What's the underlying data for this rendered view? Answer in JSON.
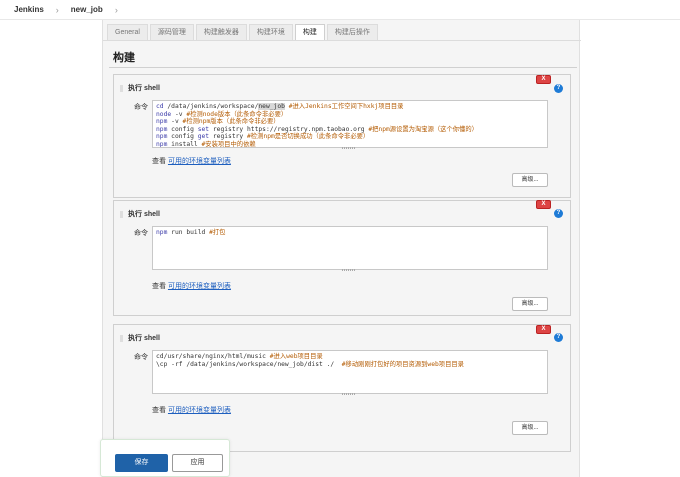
{
  "breadcrumb": {
    "root": "Jenkins",
    "sep": "›",
    "job": "new_job",
    "sep2": "›"
  },
  "tabs": [
    {
      "label": "General"
    },
    {
      "label": "源码管理"
    },
    {
      "label": "构建触发器"
    },
    {
      "label": "构建环境"
    },
    {
      "label": "构建",
      "active": true
    },
    {
      "label": "构建后操作"
    }
  ],
  "section_title": "构建",
  "steps": [
    {
      "title": "执行 shell",
      "delete": "X",
      "help": "?",
      "command_label": "命令",
      "lines": [
        "cd /data/jenkins/workspace/new_job #进入Jenkins工作空间下hxkj项目目录",
        "node -v #检测node版本（此条命令非必要）",
        "npm -v #检测npm版本（此条命令非必要）",
        "npm config set registry https://registry.npm.taobao.org #把npm源设置为淘宝源（这个你懂的）",
        "npm config get registry #检测npm是否切换成功（此条命令非必要）",
        "npm install #安装项目中的依赖"
      ],
      "env_prefix": "查看",
      "env_link": "可用的环境变量列表",
      "advanced": "高级..."
    },
    {
      "title": "执行 shell",
      "delete": "X",
      "help": "?",
      "command_label": "命令",
      "lines": [
        "npm run build #打包"
      ],
      "env_prefix": "查看",
      "env_link": "可用的环境变量列表",
      "advanced": "高级..."
    },
    {
      "title": "执行 shell",
      "delete": "X",
      "help": "?",
      "command_label": "命令",
      "lines": [
        "cd/usr/share/nginx/html/music #进入web项目目录",
        "\\cp -rf /data/jenkins/workspace/new_job/dist ./  #移动刚刚打包好的项目资源到web项目目录"
      ],
      "env_prefix": "查看",
      "env_link": "可用的环境变量列表",
      "advanced": "高级..."
    }
  ],
  "footer": {
    "save": "保存",
    "apply": "应用"
  },
  "colors": {
    "accent": "#1f62a8",
    "delete": "#dd4444",
    "link": "#1e5fbf",
    "help": "#1e7bd6"
  }
}
